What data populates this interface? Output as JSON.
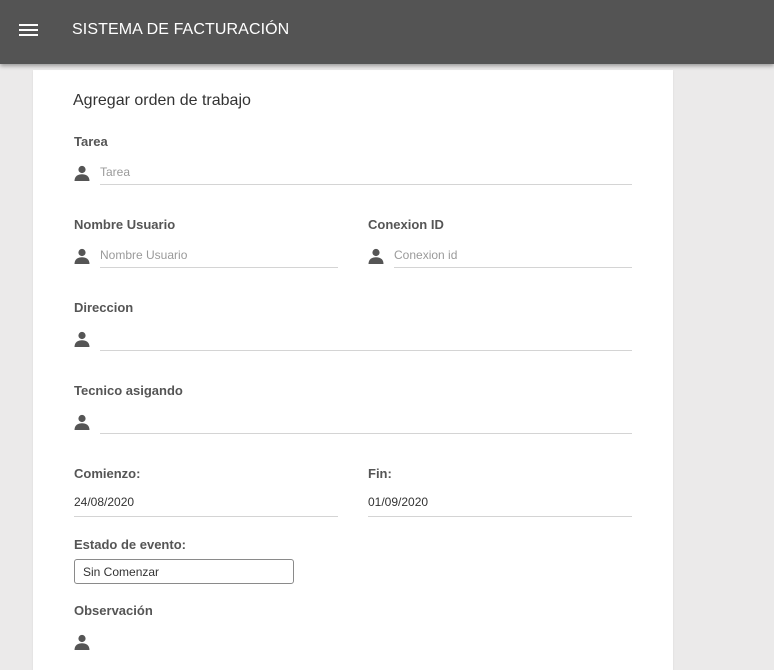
{
  "app_bar": {
    "title": "SISTEMA DE FACTURACIÓN",
    "menu_icon": "hamburger-menu-icon",
    "background": "#545454"
  },
  "form": {
    "title": "Agregar orden de trabajo",
    "fields": {
      "tarea": {
        "label": "Tarea",
        "placeholder": "Tarea",
        "value": "",
        "icon": "person-icon"
      },
      "nombre_usuario": {
        "label": "Nombre Usuario",
        "placeholder": "Nombre Usuario",
        "value": "",
        "icon": "person-icon"
      },
      "conexion_id": {
        "label": "Conexion ID",
        "placeholder": "Conexion id",
        "value": "",
        "icon": "person-icon"
      },
      "direccion": {
        "label": "Direccion",
        "placeholder": "",
        "value": "",
        "icon": "person-icon"
      },
      "tecnico": {
        "label": "Tecnico asigando",
        "placeholder": "",
        "value": "",
        "icon": "person-icon"
      },
      "comienzo": {
        "label": "Comienzo:",
        "value": "24/08/2020"
      },
      "fin": {
        "label": "Fin:",
        "value": "01/09/2020"
      },
      "estado": {
        "label": "Estado de evento:",
        "selected": "Sin Comenzar"
      },
      "observacion": {
        "label": "Observación",
        "value": "",
        "icon": "person-icon"
      }
    }
  },
  "colors": {
    "page_background": "#ebeaea",
    "card_background": "#ffffff",
    "icon": "#555555"
  }
}
